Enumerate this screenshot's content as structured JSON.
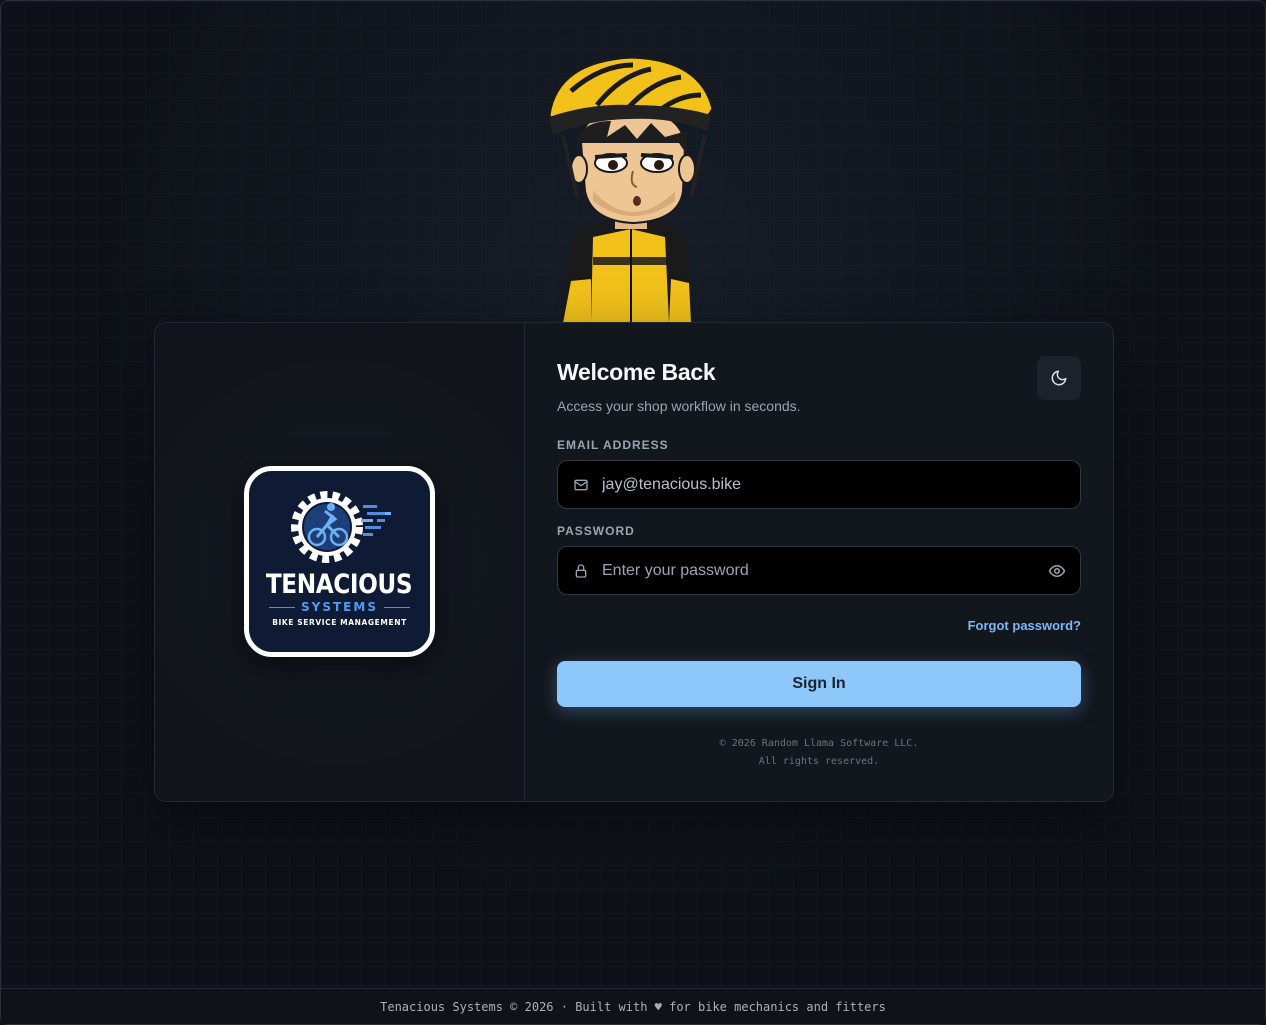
{
  "brand": {
    "name": "TENACIOUS",
    "sub": "SYSTEMS",
    "tagline": "BIKE SERVICE MANAGEMENT"
  },
  "login": {
    "title": "Welcome Back",
    "subtitle": "Access your shop workflow in seconds.",
    "email_label": "EMAIL ADDRESS",
    "email_value": "jay@tenacious.bike",
    "password_label": "PASSWORD",
    "password_placeholder": "Enter your password",
    "forgot_label": "Forgot password?",
    "signin_label": "Sign In",
    "copyright_line1": "© 2026 Random Llama Software LLC.",
    "copyright_line2": "All rights reserved."
  },
  "footer": {
    "text": "Tenacious Systems © 2026 · Built with ♥ for bike mechanics and fitters"
  },
  "colors": {
    "accent": "#8ec7fa",
    "link": "#7cb8f4",
    "background": "#0e1218",
    "card": "#12161d"
  },
  "icons": {
    "theme": "moon-icon",
    "email": "mail-icon",
    "password": "lock-icon",
    "toggle_visibility": "eye-icon"
  }
}
